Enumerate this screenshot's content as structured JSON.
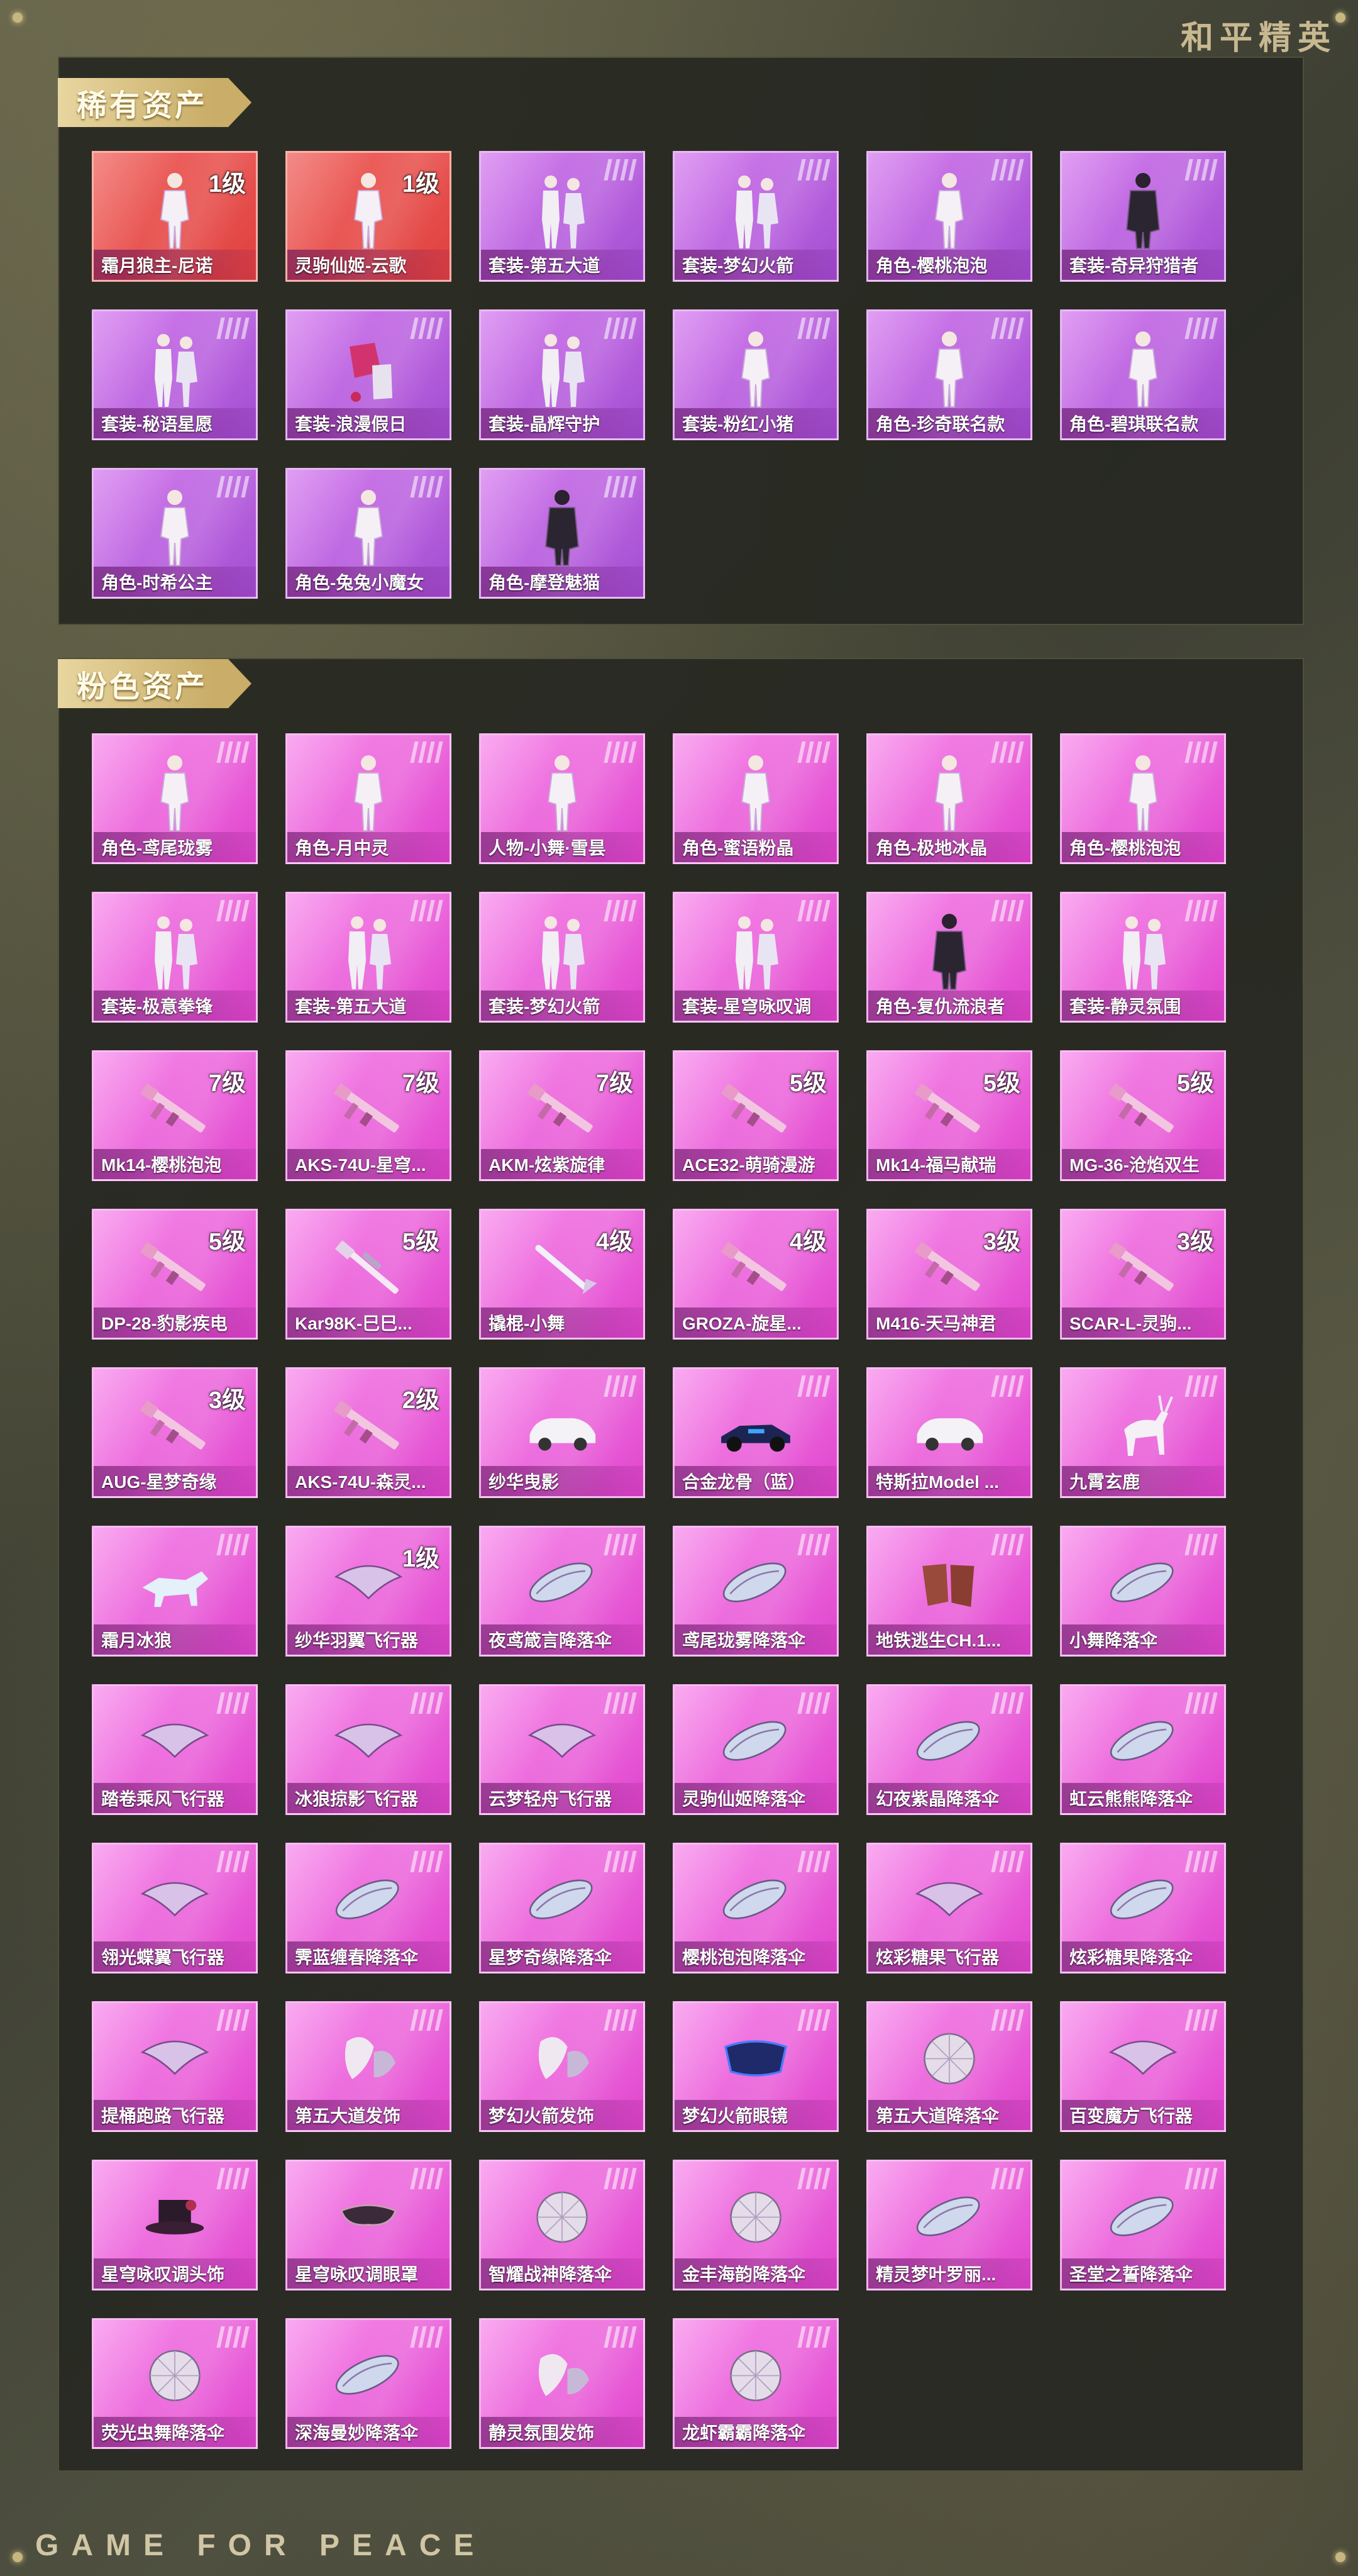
{
  "brand": "和平精英",
  "footer": "GAME FOR PEACE",
  "sections": [
    {
      "title": "稀有资产",
      "items": [
        {
          "label": "霜月狼主-尼诺",
          "level": "1级",
          "tier": "red",
          "icon": "character-figure-icon"
        },
        {
          "label": "灵驹仙姬-云歌",
          "level": "1级",
          "tier": "red",
          "icon": "character-figure-icon"
        },
        {
          "label": "套装-第五大道",
          "level": "",
          "tier": "purple",
          "icon": "outfit-pair-icon"
        },
        {
          "label": "套装-梦幻火箭",
          "level": "",
          "tier": "purple",
          "icon": "outfit-pair-icon"
        },
        {
          "label": "角色-樱桃泡泡",
          "level": "",
          "tier": "purple",
          "icon": "character-figure-icon"
        },
        {
          "label": "套装-奇异狩猎者",
          "level": "",
          "tier": "purple",
          "icon": "dark-outfit-icon"
        },
        {
          "label": "套装-秘语星愿",
          "level": "",
          "tier": "purple",
          "icon": "outfit-pair-icon"
        },
        {
          "label": "套装-浪漫假日",
          "level": "",
          "tier": "purple",
          "icon": "outfit-pieces-icon"
        },
        {
          "label": "套装-晶辉守护",
          "level": "",
          "tier": "purple",
          "icon": "outfit-pair-icon"
        },
        {
          "label": "套装-粉红小猪",
          "level": "",
          "tier": "purple",
          "icon": "character-figure-icon"
        },
        {
          "label": "角色-珍奇联名款",
          "level": "",
          "tier": "purple",
          "icon": "character-figure-icon"
        },
        {
          "label": "角色-碧琪联名款",
          "level": "",
          "tier": "purple",
          "icon": "character-figure-icon"
        },
        {
          "label": "角色-时希公主",
          "level": "",
          "tier": "purple",
          "icon": "character-figure-icon"
        },
        {
          "label": "角色-兔兔小魔女",
          "level": "",
          "tier": "purple",
          "icon": "character-figure-icon"
        },
        {
          "label": "角色-摩登魅猫",
          "level": "",
          "tier": "purple",
          "icon": "dark-outfit-icon"
        }
      ]
    },
    {
      "title": "粉色资产",
      "items": [
        {
          "label": "角色-鸢尾珑雾",
          "level": "",
          "tier": "pink",
          "icon": "character-figure-icon"
        },
        {
          "label": "角色-月中灵",
          "level": "",
          "tier": "pink",
          "icon": "character-figure-icon"
        },
        {
          "label": "人物-小舞·雪昙",
          "level": "",
          "tier": "pink",
          "icon": "character-figure-icon"
        },
        {
          "label": "角色-蜜语粉晶",
          "level": "",
          "tier": "pink",
          "icon": "character-figure-icon"
        },
        {
          "label": "角色-极地冰晶",
          "level": "",
          "tier": "pink",
          "icon": "character-figure-icon"
        },
        {
          "label": "角色-樱桃泡泡",
          "level": "",
          "tier": "pink",
          "icon": "character-figure-icon"
        },
        {
          "label": "套装-极意拳锋",
          "level": "",
          "tier": "pink",
          "icon": "outfit-pair-icon"
        },
        {
          "label": "套装-第五大道",
          "level": "",
          "tier": "pink",
          "icon": "outfit-pair-icon"
        },
        {
          "label": "套装-梦幻火箭",
          "level": "",
          "tier": "pink",
          "icon": "outfit-pair-icon"
        },
        {
          "label": "套装-星穹咏叹调",
          "level": "",
          "tier": "pink",
          "icon": "outfit-pair-icon"
        },
        {
          "label": "角色-复仇流浪者",
          "level": "",
          "tier": "pink",
          "icon": "dark-outfit-icon"
        },
        {
          "label": "套装-静灵氛围",
          "level": "",
          "tier": "pink",
          "icon": "outfit-pair-icon"
        },
        {
          "label": "Mk14-樱桃泡泡",
          "level": "7级",
          "tier": "pink",
          "icon": "rifle-icon"
        },
        {
          "label": "AKS-74U-星穹...",
          "level": "7级",
          "tier": "pink",
          "icon": "rifle-icon"
        },
        {
          "label": "AKM-炫紫旋律",
          "level": "7级",
          "tier": "pink",
          "icon": "rifle-icon"
        },
        {
          "label": "ACE32-萌骑漫游",
          "level": "5级",
          "tier": "pink",
          "icon": "rifle-icon"
        },
        {
          "label": "Mk14-福马献瑞",
          "level": "5级",
          "tier": "pink",
          "icon": "rifle-icon"
        },
        {
          "label": "MG-36-沧焰双生",
          "level": "5级",
          "tier": "pink",
          "icon": "rifle-icon"
        },
        {
          "label": "DP-28-豹影疾电",
          "level": "5级",
          "tier": "pink",
          "icon": "rifle-icon"
        },
        {
          "label": "Kar98K-巳巳...",
          "level": "5级",
          "tier": "pink",
          "icon": "sniper-rifle-icon"
        },
        {
          "label": "撬棍-小舞",
          "level": "4级",
          "tier": "pink",
          "icon": "crowbar-icon"
        },
        {
          "label": "GROZA-旋星...",
          "level": "4级",
          "tier": "pink",
          "icon": "rifle-icon"
        },
        {
          "label": "M416-天马神君",
          "level": "3级",
          "tier": "pink",
          "icon": "rifle-icon"
        },
        {
          "label": "SCAR-L-灵驹...",
          "level": "3级",
          "tier": "pink",
          "icon": "rifle-icon"
        },
        {
          "label": "AUG-星梦奇缘",
          "level": "3级",
          "tier": "pink",
          "icon": "rifle-icon"
        },
        {
          "label": "AKS-74U-森灵...",
          "level": "2级",
          "tier": "pink",
          "icon": "rifle-icon"
        },
        {
          "label": "纱华曳影",
          "level": "",
          "tier": "pink",
          "icon": "car-icon"
        },
        {
          "label": "合金龙骨（蓝）",
          "level": "",
          "tier": "pink",
          "icon": "race-car-icon"
        },
        {
          "label": "特斯拉Model ...",
          "level": "",
          "tier": "pink",
          "icon": "car-icon"
        },
        {
          "label": "九霄玄鹿",
          "level": "",
          "tier": "pink",
          "icon": "deer-mount-icon"
        },
        {
          "label": "霜月冰狼",
          "level": "",
          "tier": "pink",
          "icon": "wolf-mount-icon"
        },
        {
          "label": "纱华羽翼飞行器",
          "level": "1级",
          "tier": "pink",
          "icon": "glider-icon"
        },
        {
          "label": "夜鸢箴言降落伞",
          "level": "",
          "tier": "pink",
          "icon": "parachute-icon"
        },
        {
          "label": "鸢尾珑雾降落伞",
          "level": "",
          "tier": "pink",
          "icon": "parachute-icon"
        },
        {
          "label": "地铁逃生CH.1...",
          "level": "",
          "tier": "pink",
          "icon": "armor-plates-icon"
        },
        {
          "label": "小舞降落伞",
          "level": "",
          "tier": "pink",
          "icon": "parachute-icon"
        },
        {
          "label": "踏卷乘风飞行器",
          "level": "",
          "tier": "pink",
          "icon": "glider-icon"
        },
        {
          "label": "冰狼掠影飞行器",
          "level": "",
          "tier": "pink",
          "icon": "glider-icon"
        },
        {
          "label": "云梦轻舟飞行器",
          "level": "",
          "tier": "pink",
          "icon": "glider-icon"
        },
        {
          "label": "灵驹仙姬降落伞",
          "level": "",
          "tier": "pink",
          "icon": "parachute-icon"
        },
        {
          "label": "幻夜紫晶降落伞",
          "level": "",
          "tier": "pink",
          "icon": "parachute-icon"
        },
        {
          "label": "虹云熊熊降落伞",
          "level": "",
          "tier": "pink",
          "icon": "parachute-icon"
        },
        {
          "label": "翎光蝶翼飞行器",
          "level": "",
          "tier": "pink",
          "icon": "glider-icon"
        },
        {
          "label": "霁蓝缠春降落伞",
          "level": "",
          "tier": "pink",
          "icon": "parachute-icon"
        },
        {
          "label": "星梦奇缘降落伞",
          "level": "",
          "tier": "pink",
          "icon": "parachute-icon"
        },
        {
          "label": "樱桃泡泡降落伞",
          "level": "",
          "tier": "pink",
          "icon": "parachute-icon"
        },
        {
          "label": "炫彩糖果飞行器",
          "level": "",
          "tier": "pink",
          "icon": "glider-icon"
        },
        {
          "label": "炫彩糖果降落伞",
          "level": "",
          "tier": "pink",
          "icon": "parachute-icon"
        },
        {
          "label": "提桶跑路飞行器",
          "level": "",
          "tier": "pink",
          "icon": "glider-icon"
        },
        {
          "label": "第五大道发饰",
          "level": "",
          "tier": "pink",
          "icon": "hair-accessory-icon"
        },
        {
          "label": "梦幻火箭发饰",
          "level": "",
          "tier": "pink",
          "icon": "hair-accessory-icon"
        },
        {
          "label": "梦幻火箭眼镜",
          "level": "",
          "tier": "pink",
          "icon": "goggles-icon"
        },
        {
          "label": "第五大道降落伞",
          "level": "",
          "tier": "pink",
          "icon": "parachute-round-icon"
        },
        {
          "label": "百变魔方飞行器",
          "level": "",
          "tier": "pink",
          "icon": "glider-icon"
        },
        {
          "label": "星穹咏叹调头饰",
          "level": "",
          "tier": "pink",
          "icon": "hat-icon"
        },
        {
          "label": "星穹咏叹调眼罩",
          "level": "",
          "tier": "pink",
          "icon": "mask-icon"
        },
        {
          "label": "智耀战神降落伞",
          "level": "",
          "tier": "pink",
          "icon": "parachute-round-icon"
        },
        {
          "label": "金丰海韵降落伞",
          "level": "",
          "tier": "pink",
          "icon": "parachute-round-icon"
        },
        {
          "label": "精灵梦叶罗丽...",
          "level": "",
          "tier": "pink",
          "icon": "parachute-icon"
        },
        {
          "label": "圣堂之誓降落伞",
          "level": "",
          "tier": "pink",
          "icon": "parachute-icon"
        },
        {
          "label": "荧光虫舞降落伞",
          "level": "",
          "tier": "pink",
          "icon": "parachute-round-icon"
        },
        {
          "label": "深海曼妙降落伞",
          "level": "",
          "tier": "pink",
          "icon": "parachute-icon"
        },
        {
          "label": "静灵氛围发饰",
          "level": "",
          "tier": "pink",
          "icon": "hair-accessory-icon"
        },
        {
          "label": "龙虾霸霸降落伞",
          "level": "",
          "tier": "pink",
          "icon": "parachute-round-icon"
        }
      ]
    }
  ]
}
